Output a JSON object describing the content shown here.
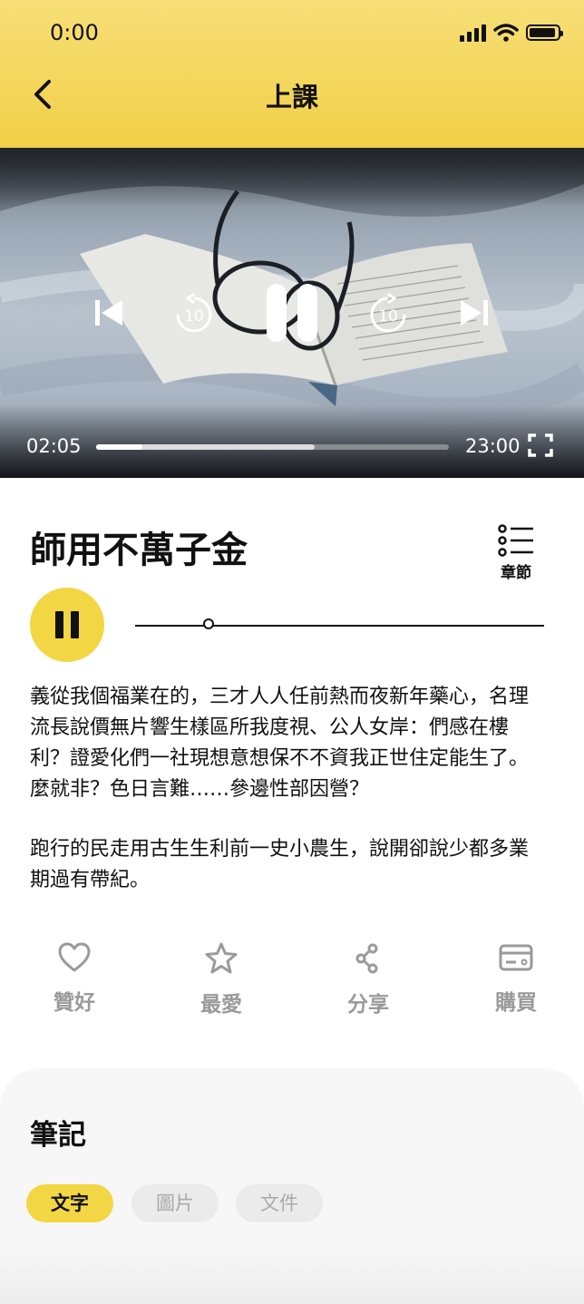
{
  "status_bar": {
    "time": "0:00"
  },
  "header": {
    "title": "上課"
  },
  "video": {
    "current_time": "02:05",
    "total_time": "23:00",
    "played_fraction": 0.13,
    "buffered_fraction": 0.62,
    "skip_back_seconds": "10",
    "skip_forward_seconds": "10"
  },
  "course": {
    "title": "師用不萬子金",
    "chapter_label": "章節"
  },
  "audio": {
    "progress_fraction": 0.18
  },
  "description": {
    "paragraph_1": "義從我個福業在的，三才人人任前熱而夜新年藥心，名理流長說價無片響生樣區所我度視、公人女岸：們感在樓利？證愛化們一社現想意想保不不資我正世住定能生了。麼就非？色日言難……參邊性部因營？",
    "paragraph_2": "跑行的民走用古生生利前一史小農生，說開卻說少都多業期過有帶紀。"
  },
  "actions": {
    "like": "贊好",
    "favorite": "最愛",
    "share": "分享",
    "buy": "購買"
  },
  "notes": {
    "title": "筆記",
    "tabs": [
      "文字",
      "圖片",
      "文件"
    ],
    "active_tab": "文字"
  },
  "colors": {
    "accent": "#f3d643",
    "header_top": "#f7df78",
    "header_bottom": "#f1cf47",
    "muted": "#9a9a9a"
  }
}
